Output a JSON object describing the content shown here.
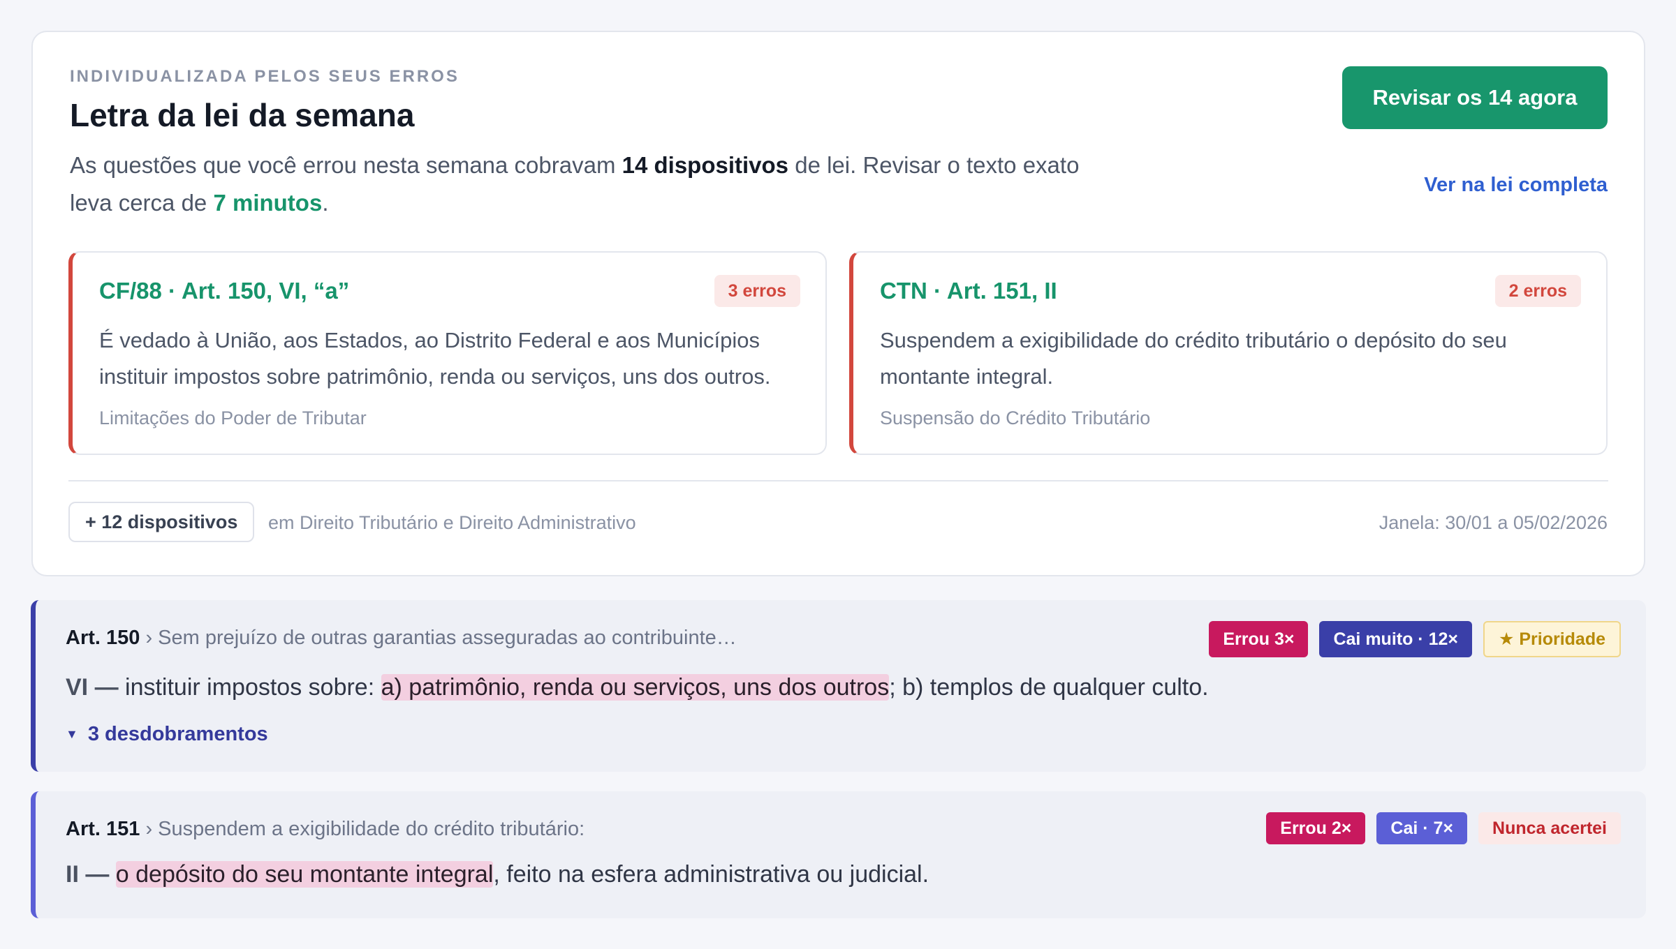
{
  "summary": {
    "eyebrow": "INDIVIDUALIZADA PELOS SEUS ERROS",
    "title": "Letra da lei da semana",
    "intro_part1": "As questões que você errou nesta semana cobravam ",
    "intro_count": "14 dispositivos",
    "intro_part2": " de lei. Revisar o texto exato leva cerca de ",
    "intro_time": "7 minutos",
    "intro_part3": ".",
    "primary_button": "Revisar os 14 agora",
    "secondary_link": "Ver na lei completa",
    "more_button": "+ 12 dispositivos",
    "more_description": "em Direito Tributário e Direito Administrativo",
    "window": "Janela: 30/01 a 05/02/2026"
  },
  "law_cards": [
    {
      "reference": "CF/88 · Art. 150, VI, “a”",
      "errors": "3 erros",
      "text": "É vedado à União, aos Estados, ao Distrito Federal e aos Municípios instituir impostos sobre patrimônio, renda ou serviços, uns dos outros.",
      "topic": "Limitações do Poder de Tributar"
    },
    {
      "reference": "CTN · Art. 151, II",
      "errors": "2 erros",
      "text": "Suspendem a exigibilidade do crédito tributário o depósito do seu montante integral.",
      "topic": "Suspensão do Crédito Tributário"
    }
  ],
  "articles": [
    {
      "number": "Art. 150",
      "separator": " › ",
      "caput": "Sem prejuízo de outras garantias asseguradas ao contribuinte…",
      "tags": [
        "Errou 3×",
        "Cai muito · 12×",
        "★ Prioridade"
      ],
      "lead": "VI —",
      "before": " instituir impostos sobre: ",
      "highlight": "a) patrimônio, renda ou serviços, uns dos outros",
      "after": "; b) templos de qualquer culto.",
      "expand_label": "3 desdobramentos",
      "expand_icon": "triangle-down-icon"
    },
    {
      "number": "Art. 151",
      "separator": " › ",
      "caput": "Suspendem a exigibilidade do crédito tributário:",
      "tags": [
        "Errou 2×",
        "Cai · 7×",
        "Nunca acertei"
      ],
      "lead": "II —",
      "before": " ",
      "highlight": "o depósito do seu montante integral",
      "after": ", feito na esfera administrativa ou judicial."
    }
  ],
  "colors": {
    "accent_green": "#18966c",
    "error_red": "#d2473d",
    "link_blue": "#2f5fd0",
    "indigo": "#3a3fa8",
    "magenta": "#c8195e",
    "highlight_pink": "#f3cfe0"
  }
}
